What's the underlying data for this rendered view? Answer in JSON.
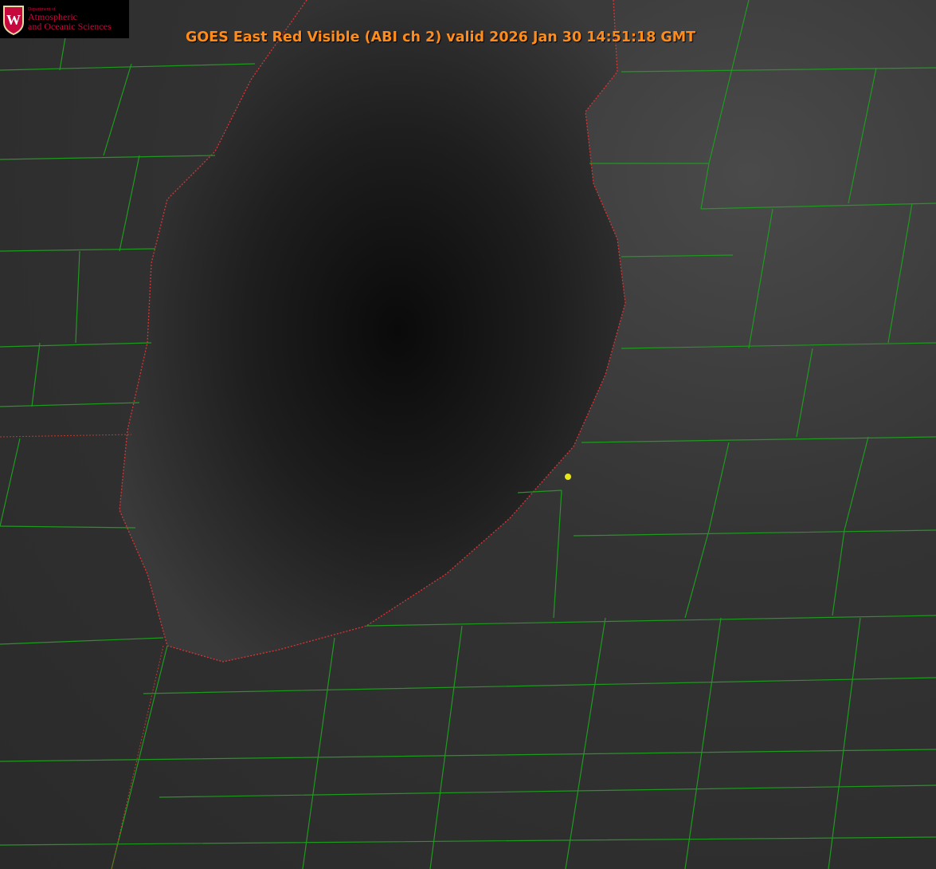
{
  "title": "GOES East Red Visible (ABI ch 2) valid 2026 Jan 30 14:51:18 GMT",
  "logo": {
    "dept": "Department of",
    "line1": "Atmospheric",
    "line2": "and Oceanic Sciences",
    "crest_letter": "W"
  },
  "colors": {
    "title": "#ff8c1a",
    "county_lines": "#1f9a1f",
    "state_lines": "#c0392b",
    "marker": "#e6e619",
    "logo_text": "#c5083e"
  }
}
